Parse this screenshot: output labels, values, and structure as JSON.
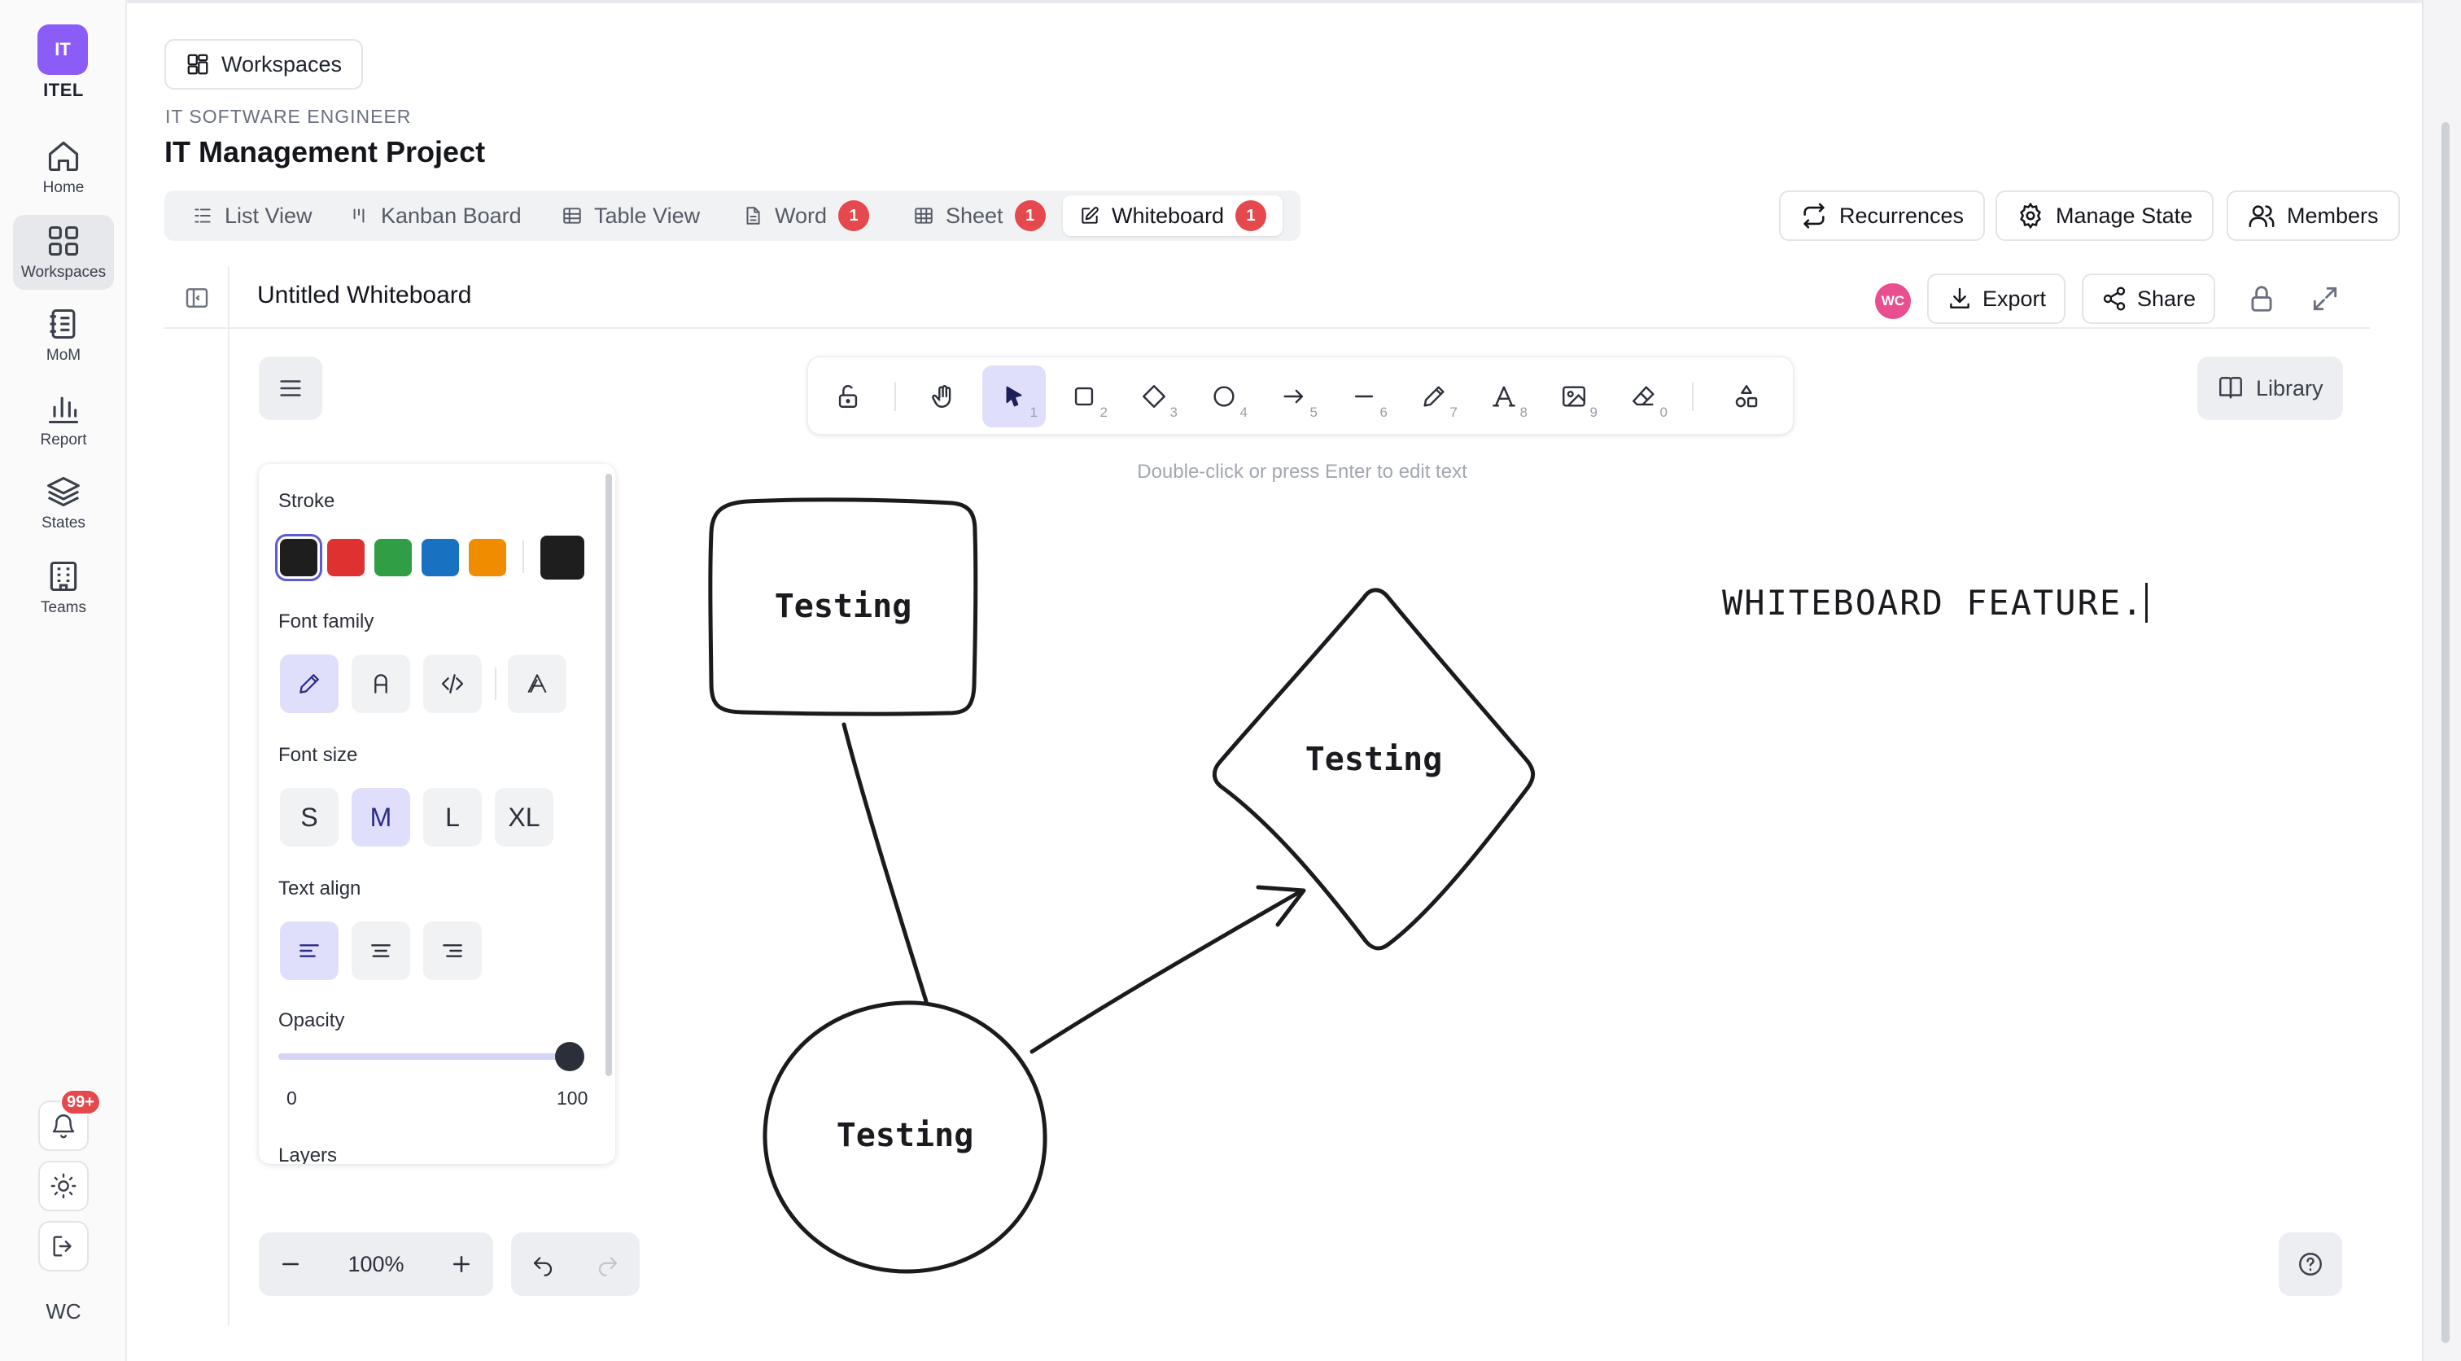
{
  "org": {
    "initials": "IT",
    "name": "ITEL"
  },
  "nav": [
    {
      "label": "Home",
      "icon": "home-icon"
    },
    {
      "label": "Workspaces",
      "icon": "grid-icon"
    },
    {
      "label": "MoM",
      "icon": "notebook-icon"
    },
    {
      "label": "Report",
      "icon": "bar-chart-icon"
    },
    {
      "label": "States",
      "icon": "layers-icon"
    },
    {
      "label": "Teams",
      "icon": "building-icon"
    }
  ],
  "rail_bottom": {
    "notifications_badge": "99+",
    "user_initials": "WC"
  },
  "header": {
    "workspaces_button": "Workspaces",
    "subtitle": "IT SOFTWARE ENGINEER",
    "project_title": "IT Management Project"
  },
  "tabs": [
    {
      "label": "List View"
    },
    {
      "label": "Kanban Board"
    },
    {
      "label": "Table View"
    },
    {
      "label": "Word",
      "count": "1"
    },
    {
      "label": "Sheet",
      "count": "1"
    },
    {
      "label": "Whiteboard",
      "count": "1",
      "active": true
    }
  ],
  "actions": {
    "recurrences": "Recurrences",
    "manage_state": "Manage State",
    "members": "Members"
  },
  "board": {
    "title": "Untitled Whiteboard",
    "collaborator_initials": "WC",
    "export": "Export",
    "share": "Share"
  },
  "toolbar": {
    "tools": [
      {
        "name": "lock",
        "key": ""
      },
      {
        "name": "hand",
        "key": ""
      },
      {
        "name": "selection",
        "key": "1",
        "active": true
      },
      {
        "name": "rectangle",
        "key": "2"
      },
      {
        "name": "diamond",
        "key": "3"
      },
      {
        "name": "ellipse",
        "key": "4"
      },
      {
        "name": "arrow",
        "key": "5"
      },
      {
        "name": "line",
        "key": "6"
      },
      {
        "name": "draw",
        "key": "7"
      },
      {
        "name": "text",
        "key": "8"
      },
      {
        "name": "image",
        "key": "9"
      },
      {
        "name": "eraser",
        "key": "0"
      },
      {
        "name": "more-shapes",
        "key": ""
      }
    ],
    "hint": "Double-click or press Enter to edit text",
    "library": "Library"
  },
  "panel": {
    "stroke_label": "Stroke",
    "stroke_colors": [
      "#1e1e1e",
      "#e03131",
      "#2f9e44",
      "#1971c2",
      "#f08c00"
    ],
    "current_stroke": "#1e1e1e",
    "font_family_label": "Font family",
    "font_size_label": "Font size",
    "font_sizes": [
      "S",
      "M",
      "L",
      "XL"
    ],
    "selected_font_size": "M",
    "text_align_label": "Text align",
    "opacity_label": "Opacity",
    "opacity_min": "0",
    "opacity_max": "100",
    "opacity_value": 100,
    "layers_label": "Layers"
  },
  "zoom": {
    "level": "100%"
  },
  "canvas": {
    "rectangle_text": "Testing",
    "diamond_text": "Testing",
    "circle_text": "Testing",
    "free_text": "WHITEBOARD FEATURE."
  }
}
